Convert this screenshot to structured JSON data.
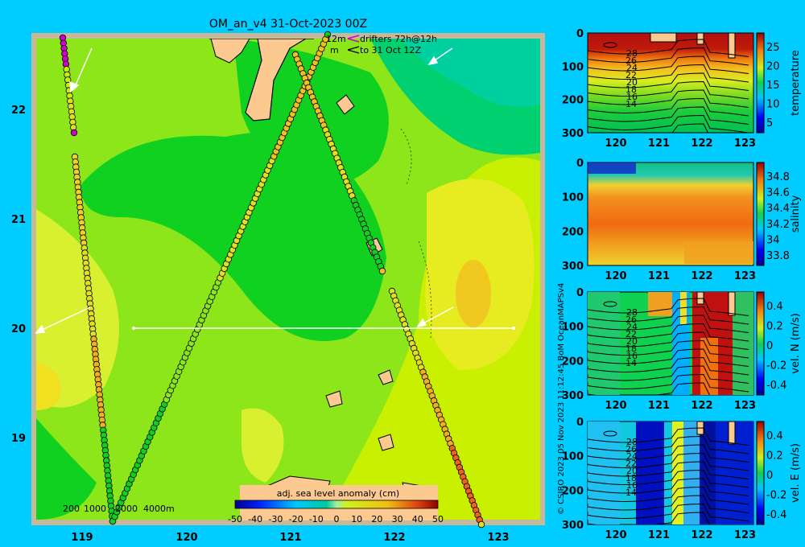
{
  "title": "OM_an_v4  31-Oct-2023 00Z",
  "map": {
    "lat_ticks": [
      "22",
      "21",
      "20",
      "19"
    ],
    "lon_ticks": [
      "119",
      "120",
      "121",
      "122",
      "123"
    ],
    "depth_legend": [
      "200",
      "1000",
      "2000",
      "4000m"
    ],
    "drifter_legend": {
      "line1_left": "12m",
      "line1_right": "drifters 72h@12h",
      "line2_left": "m",
      "line2_right": "to 31 Oct 12Z"
    },
    "colorbar": {
      "label": "adj. sea level anomaly (cm)",
      "ticks": [
        "-50",
        "-40",
        "-30",
        "-20",
        "-10",
        "0",
        "10",
        "20",
        "30",
        "40",
        "50"
      ]
    },
    "colors": {
      "land": "#fcc990",
      "background": "#00ccff",
      "frame": "#c8b89a"
    }
  },
  "side_panels": {
    "x_ticks": [
      "120",
      "121",
      "122",
      "123"
    ],
    "depth_ticks": [
      "0",
      "100",
      "200",
      "300"
    ],
    "panels": [
      {
        "name": "temperature",
        "label": "temperature",
        "cbar_ticks": [
          "25",
          "20",
          "15",
          "10",
          "5"
        ],
        "contour_labels": [
          "28",
          "26",
          "24",
          "22",
          "20",
          "18",
          "16",
          "14"
        ]
      },
      {
        "name": "salinity",
        "label": "salinity",
        "cbar_ticks": [
          "34.8",
          "34.6",
          "34.4",
          "34.2",
          "34",
          "33.8"
        ],
        "contour_labels": []
      },
      {
        "name": "vel-n",
        "label": "vel. N (m/s)",
        "cbar_ticks": [
          "0.4",
          "0.2",
          "0",
          "-0.2",
          "-0.4"
        ],
        "contour_labels": [
          "28",
          "26",
          "24",
          "22",
          "20",
          "18",
          "16",
          "14"
        ]
      },
      {
        "name": "vel-e",
        "label": "vel. E (m/s)",
        "cbar_ticks": [
          "0.4",
          "0.2",
          "0",
          "-0.2",
          "-0.4"
        ],
        "contour_labels": [
          "28",
          "26",
          "24",
          "22",
          "20",
          "18",
          "16",
          "14"
        ]
      }
    ]
  },
  "credit": "© CSIRO 2023   05 Nov 2023 11:12:45 BoM OceanMAPSv4"
}
